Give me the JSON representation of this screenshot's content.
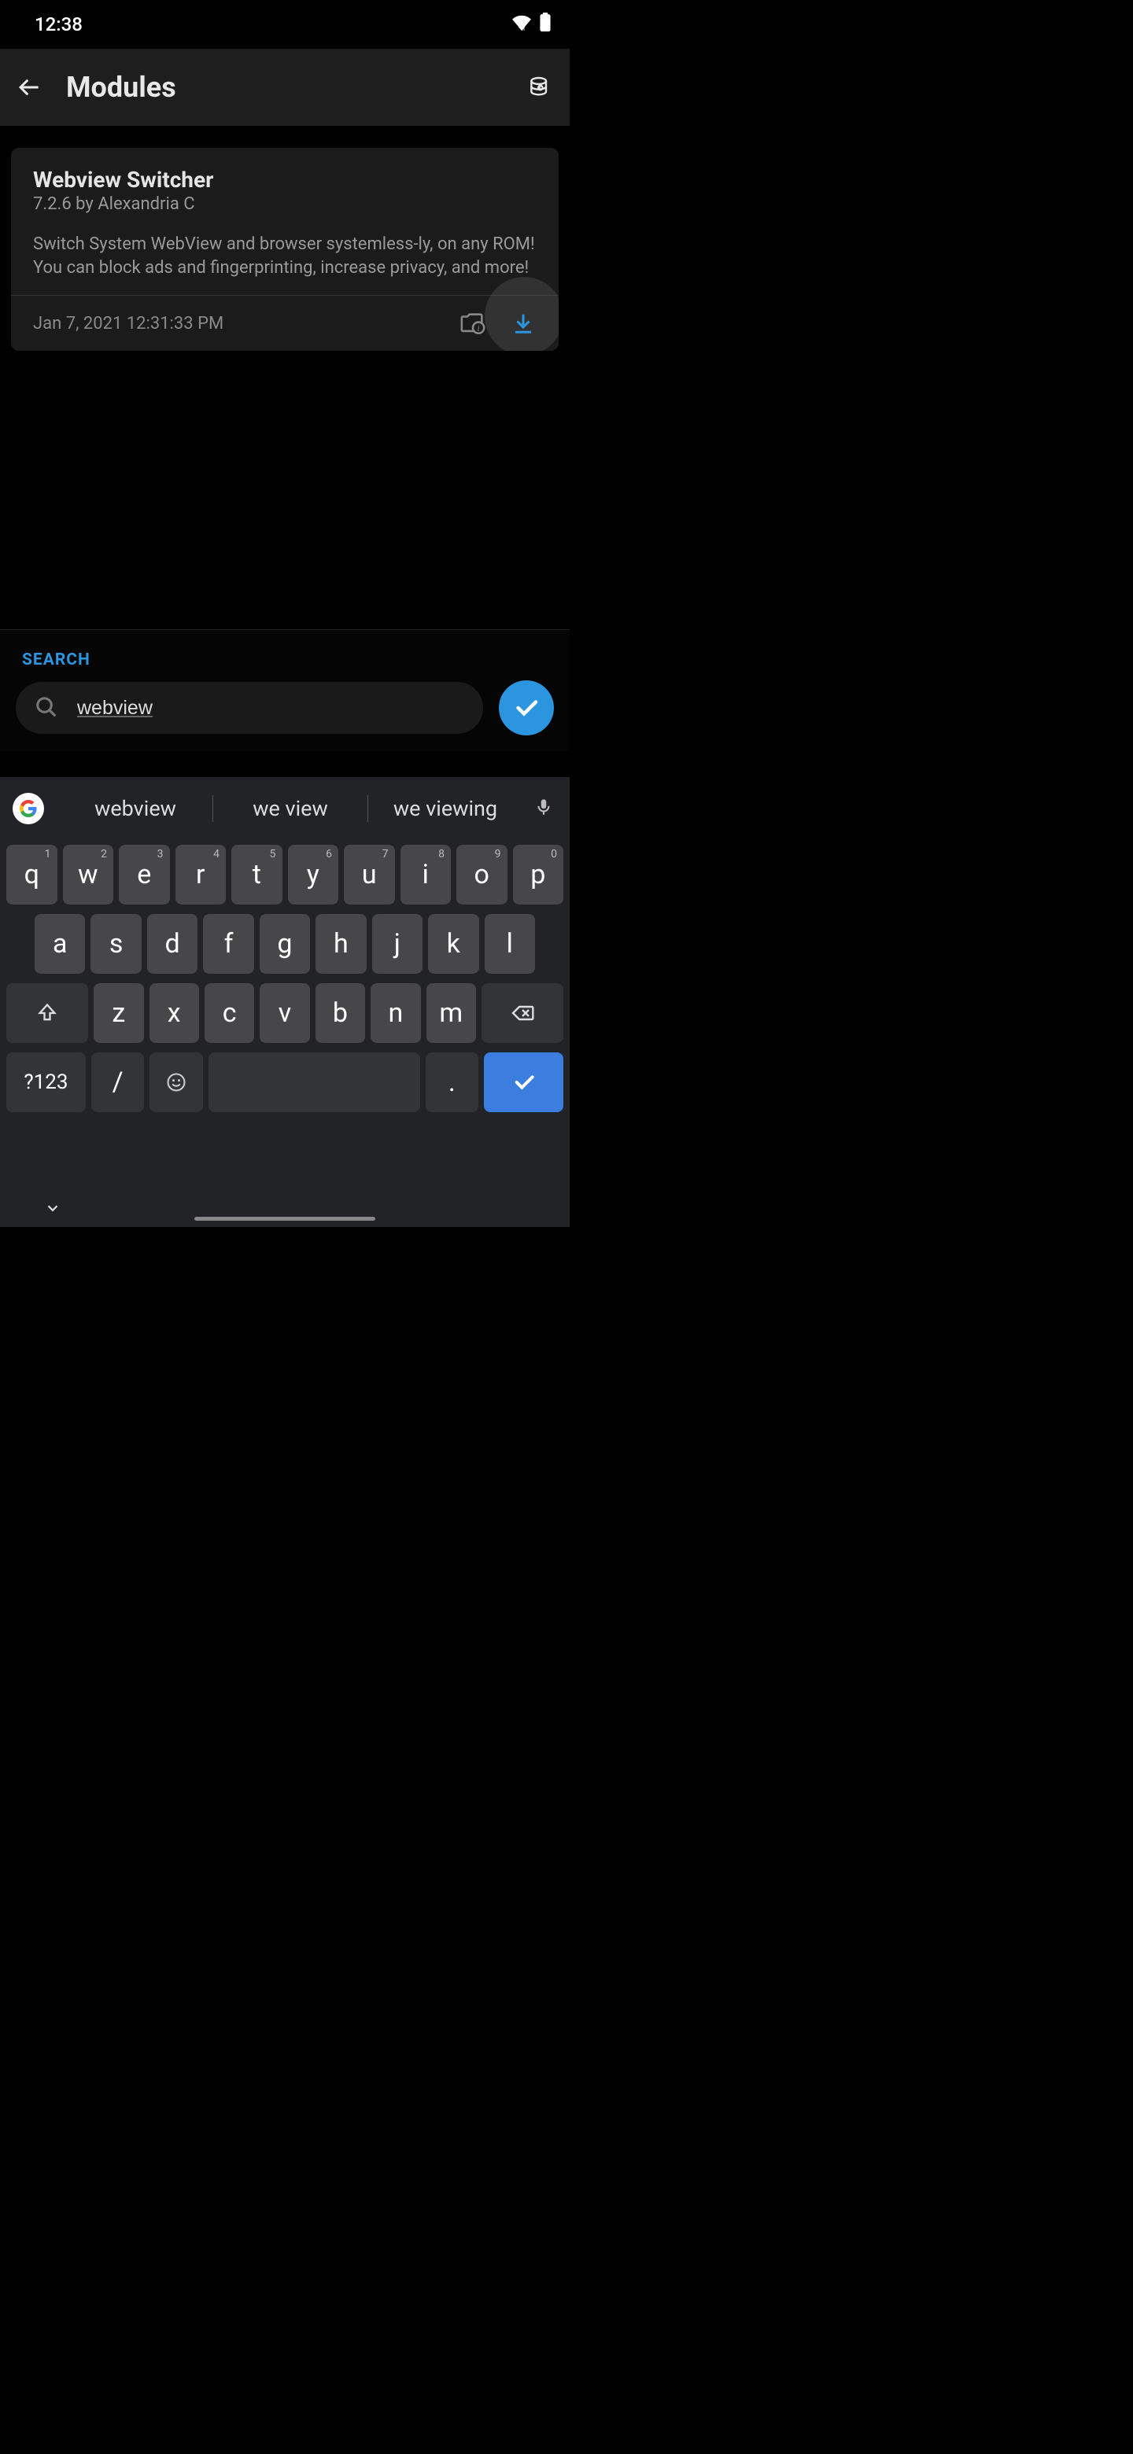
{
  "status": {
    "time": "12:38"
  },
  "header": {
    "title": "Modules"
  },
  "module": {
    "name": "Webview Switcher",
    "meta": "7.2.6 by Alexandria C",
    "description": "Switch System WebView and browser systemless-ly, on any ROM! You can block ads and fingerprinting, increase privacy, and more!",
    "date": "Jan 7, 2021 12:31:33 PM"
  },
  "search": {
    "label": "SEARCH",
    "value": "webview"
  },
  "suggestions": [
    "webview",
    "we view",
    "we viewing"
  ],
  "keyboard": {
    "row1": [
      {
        "k": "q",
        "n": "1"
      },
      {
        "k": "w",
        "n": "2"
      },
      {
        "k": "e",
        "n": "3"
      },
      {
        "k": "r",
        "n": "4"
      },
      {
        "k": "t",
        "n": "5"
      },
      {
        "k": "y",
        "n": "6"
      },
      {
        "k": "u",
        "n": "7"
      },
      {
        "k": "i",
        "n": "8"
      },
      {
        "k": "o",
        "n": "9"
      },
      {
        "k": "p",
        "n": "0"
      }
    ],
    "row2": [
      "a",
      "s",
      "d",
      "f",
      "g",
      "h",
      "j",
      "k",
      "l"
    ],
    "row3": [
      "z",
      "x",
      "c",
      "v",
      "b",
      "n",
      "m"
    ],
    "symnum": "?123",
    "slash": "/",
    "period": "."
  },
  "colors": {
    "accent": "#2b95e0"
  }
}
